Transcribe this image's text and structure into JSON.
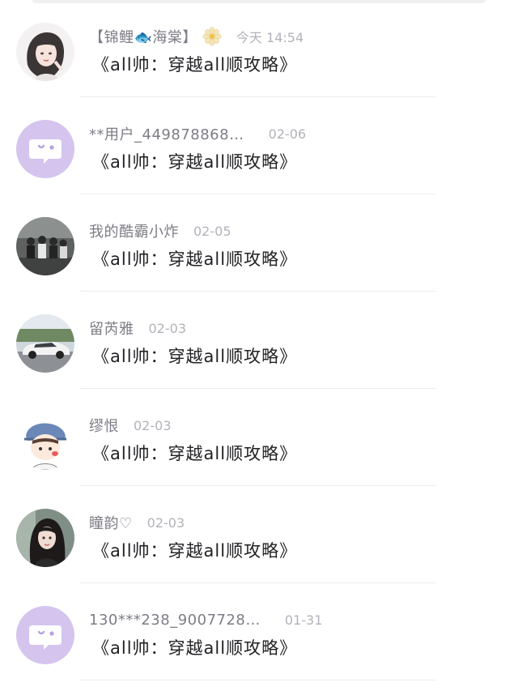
{
  "comments": [
    {
      "name": "【锦鲤🐟海棠】",
      "time": "今天 14:54",
      "message": "《all帅：穿越all顺攻略》",
      "avatar": "woman-illustration-avatar"
    },
    {
      "name": "**用户_449878868…",
      "time": "02-06",
      "message": "《all帅：穿越all顺攻略》",
      "avatar": "default-chat-avatar"
    },
    {
      "name": "我的酷霸小炸",
      "time": "02-05",
      "message": "《all帅：穿越all顺攻略》",
      "avatar": "group-photo-avatar"
    },
    {
      "name": "留芮雅",
      "time": "02-03",
      "message": "《all帅：穿越all顺攻略》",
      "avatar": "car-photo-avatar"
    },
    {
      "name": "缪恨",
      "time": "02-03",
      "message": "《all帅：穿越all顺攻略》",
      "avatar": "cartoon-boy-avatar"
    },
    {
      "name": "瞳韵♡",
      "time": "02-03",
      "message": "《all帅：穿越all顺攻略》",
      "avatar": "girl-photo-avatar"
    },
    {
      "name": "130***238_9007728…",
      "time": "01-31",
      "message": "《all帅：穿越all顺攻略》",
      "avatar": "default-chat-avatar"
    }
  ],
  "colors": {
    "name": "#7d7d86",
    "time": "#b2b2ba",
    "message": "#222226",
    "default_avatar_bg": "#d4c4ee",
    "divider": "#ececf0"
  }
}
